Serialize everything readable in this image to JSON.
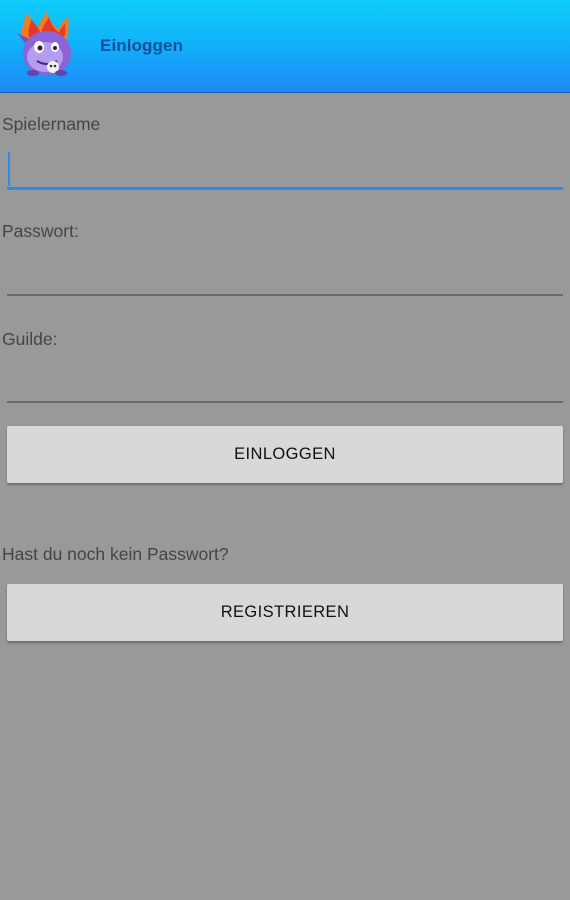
{
  "header": {
    "title": "Einloggen",
    "icon": "monster-mascot-icon",
    "gradient_top": "#0fcdfb",
    "gradient_bottom": "#1e89f6"
  },
  "form": {
    "playername_label": "Spielername",
    "playername_value": "",
    "password_label": "Passwort:",
    "password_value": "",
    "guild_label": "Guilde:",
    "guild_value": "",
    "login_button": "EINLOGGEN",
    "no_password_hint": "Hast du noch kein Passwort?",
    "register_button": "REGISTRIEREN"
  },
  "colors": {
    "background": "#999999",
    "focus_accent": "#2a8af0",
    "button": "#d8d8d8"
  }
}
